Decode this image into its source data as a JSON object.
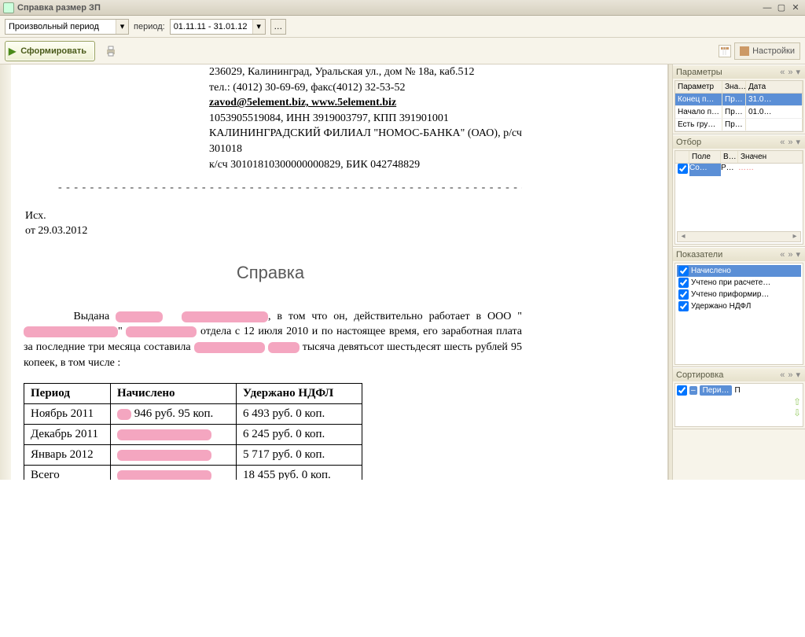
{
  "window": {
    "title": "Справка размер ЗП"
  },
  "toolbar": {
    "period_mode": "Произвольный период",
    "period_label": "период:",
    "period_value": "01.11.11 - 31.01.12",
    "generate": "Сформировать",
    "settings": "Настройки"
  },
  "document": {
    "addr1": "236029, Калининград, Уральская ул., дом № 18а, каб.512",
    "addr2": "тел.: (4012) 30-69-69, факс(4012) 32-53-52",
    "email_site": "zavod@5element.biz, www.5element.biz",
    "reg": "1053905519084, ИНН 3919003797, КПП 391901001",
    "bank1": "КАЛИНИНГРАДСКИЙ ФИЛИАЛ \"НОМОС-БАНКА\" (ОАО), р/сч 301018",
    "bank2": "к/сч 30101810300000000829, БИК 042748829",
    "out_no": "Исх.",
    "out_date": "от 29.03.2012",
    "title": "Справка",
    "body_pre": "Выдана ",
    "body_mid1": ", в том что он, действительно работает в ООО \"",
    "body_mid2": "\" ",
    "body_mid3": " отдела с 12 июля 2010 и по настоящее время, его заработная плата за последние три месяца составила",
    "body_tail": " тысяча девятьсот шестьдесят шесть рублей 95 копеек, в том числе :"
  },
  "chart_data": {
    "type": "table",
    "columns": [
      "Период",
      "Начислено",
      "Удержано НДФЛ"
    ],
    "rows": [
      {
        "period": "Ноябрь 2011",
        "accrued": "946 руб.  95 коп.",
        "accrued_redacted": true,
        "ndfl": "6 493 руб.  0 коп."
      },
      {
        "period": "Декабрь 2011",
        "accrued": "",
        "accrued_redacted": true,
        "ndfl": "6 245 руб.  0 коп."
      },
      {
        "period": "Январь 2012",
        "accrued": "",
        "accrued_redacted": true,
        "ndfl": "5 717 руб.  0 коп."
      },
      {
        "period": "Всего",
        "accrued": "",
        "accrued_redacted": true,
        "ndfl": "18 455 руб. 0 коп."
      }
    ]
  },
  "panels": {
    "params": {
      "title": "Параметры",
      "headers": [
        "Параметр",
        "Зна…",
        "Дата"
      ],
      "rows": [
        {
          "p": "Конец п…",
          "v": "Пр…",
          "d": "31.0…",
          "sel": true
        },
        {
          "p": "Начало п…",
          "v": "Пр…",
          "d": "01.0…"
        },
        {
          "p": "Есть гру…",
          "v": "Пр…",
          "d": ""
        }
      ]
    },
    "otbor": {
      "title": "Отбор",
      "headers": [
        "",
        "Поле",
        "В…",
        "Значен"
      ],
      "row": {
        "chk": true,
        "pole": "Со…",
        "v": "Р…",
        "val": "……"
      }
    },
    "indicators": {
      "title": "Показатели",
      "items": [
        {
          "label": "Начислено",
          "sel": true
        },
        {
          "label": "Учтено при расчете…"
        },
        {
          "label": "Учтено приформир…"
        },
        {
          "label": "Удержано НДФЛ"
        }
      ]
    },
    "sort": {
      "title": "Сортировка",
      "item": "Пери…",
      "after": "П"
    }
  }
}
